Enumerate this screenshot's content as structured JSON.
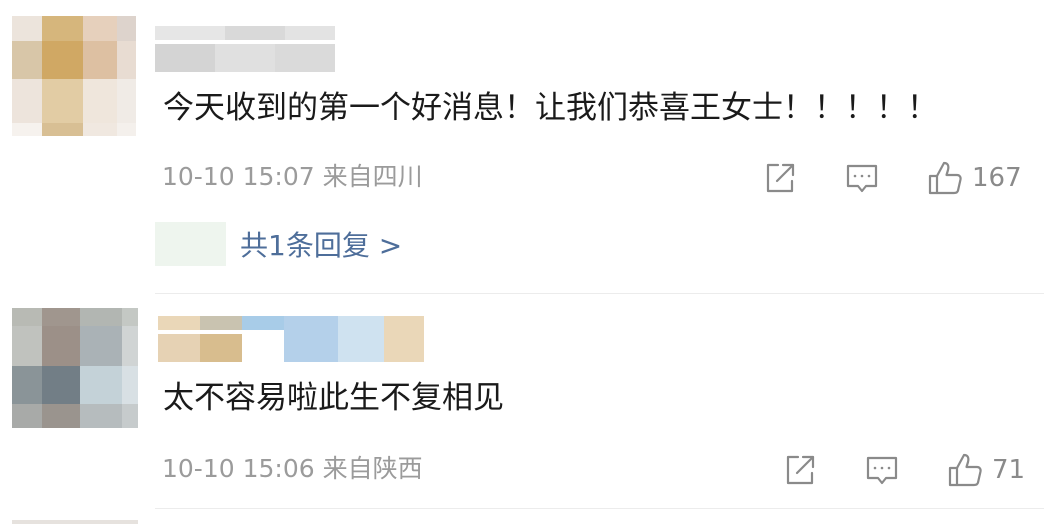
{
  "comments": [
    {
      "avatar_colors": [
        "#ece4dc",
        "#d6b67c",
        "#e6d0bc",
        "#ddd3cc",
        "#d8c6a8",
        "#d0a864",
        "#ddc0a2",
        "#e8dcd2",
        "#ede4dc",
        "#e2cca4",
        "#efe6dc",
        "#f0ebe6",
        "#f6f2ee",
        "#d8bf94",
        "#f0e8e0",
        "#f4f0ec"
      ],
      "name_colors": [
        "#e6e6e6",
        "#d9d9d9",
        "#e3e3e3",
        "#d4d4d4",
        "#e0e0e0",
        "#dadada"
      ],
      "text": "今天收到的第一个好消息！让我们恭喜王女士！！！！！",
      "date": "10-10 15:07",
      "location": "来自四川",
      "likes": "167",
      "replies_label": "共1条回复 >"
    },
    {
      "avatar_colors": [
        "#b8bab4",
        "#a0968e",
        "#b2b6b2",
        "#c4c8c4",
        "#c0c2be",
        "#9c9088",
        "#aab2b6",
        "#d0d4d4",
        "#8a9498",
        "#727e86",
        "#c4d2d8",
        "#d8e0e4",
        "#a8aaa8",
        "#9a948e",
        "#b6bcbe",
        "#c6cbcc"
      ],
      "name_colors": [
        "#ead7b8",
        "#c9c3b0",
        "#a8cce8",
        "#e6d2b4",
        "#d8bd8e",
        "#b4d0ea",
        "#cfe2f0"
      ],
      "text": "太不容易啦此生不复相见",
      "date": "10-10 15:06",
      "location": "来自陕西",
      "likes": "71"
    }
  ],
  "icons": {
    "share": "share-icon",
    "comment": "comment-icon",
    "like": "thumbs-up-icon"
  },
  "colors": {
    "text": "#1a1a1a",
    "meta": "#9b9b9b",
    "icon": "#8a8a8a",
    "link": "#4e6e9a"
  }
}
